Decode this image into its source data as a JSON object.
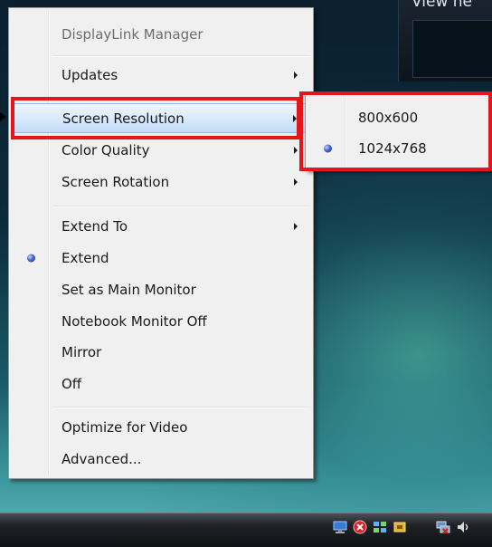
{
  "background_window": {
    "title": "View ne"
  },
  "main_menu": {
    "header": "DisplayLink Manager",
    "items": [
      {
        "label": "Updates",
        "has_submenu": true
      },
      {
        "label": "Screen Resolution",
        "has_submenu": true,
        "highlighted": true
      },
      {
        "label": "Color Quality",
        "has_submenu": true
      },
      {
        "label": "Screen Rotation",
        "has_submenu": true
      },
      {
        "label": "Extend To",
        "has_submenu": true
      },
      {
        "label": "Extend",
        "selected": true
      },
      {
        "label": "Set as Main Monitor"
      },
      {
        "label": "Notebook Monitor Off"
      },
      {
        "label": "Mirror"
      },
      {
        "label": "Off"
      },
      {
        "label": "Optimize for Video"
      },
      {
        "label": "Advanced..."
      }
    ]
  },
  "resolution_submenu": {
    "items": [
      {
        "label": "800x600",
        "selected": false
      },
      {
        "label": "1024x768",
        "selected": true
      }
    ]
  },
  "taskbar": {
    "tray_icons": [
      "monitor-icon",
      "error-shield-icon",
      "display-link-icon",
      "security-icon",
      "network-icon",
      "volume-icon"
    ]
  },
  "colors": {
    "annotation_red": "#e4161b",
    "highlight_border": "#8fb8e8",
    "radio_blue": "#4466cc"
  }
}
